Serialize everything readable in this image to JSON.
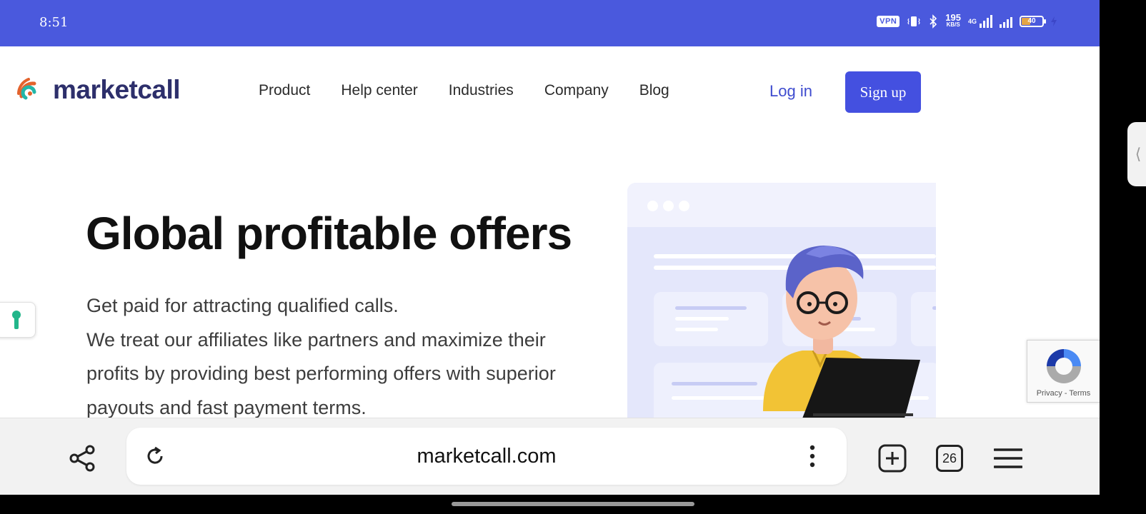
{
  "status_bar": {
    "time": "8:51",
    "vpn": "VPN",
    "speed_value": "195",
    "speed_unit": "KB/S",
    "network": "4G",
    "battery": "40",
    "bg_color": "#4a59dd"
  },
  "header": {
    "logo_text": "marketcall",
    "nav": [
      "Product",
      "Help center",
      "Industries",
      "Company",
      "Blog"
    ],
    "login_label": "Log in",
    "signup_label": "Sign up",
    "accent_color": "#4450e0"
  },
  "hero": {
    "title": "Global profitable offers",
    "line1": "Get paid for attracting qualified calls.",
    "line2": "We treat our affiliates like partners and maximize their profits by providing best performing offers with superior payouts and fast payment terms."
  },
  "recaptcha": {
    "privacy": "Privacy",
    "separator": "-",
    "terms": "Terms"
  },
  "browser": {
    "url": "marketcall.com",
    "tab_count": "26",
    "icons": [
      "share-icon",
      "reload-icon",
      "more-vertical-icon",
      "new-tab-icon",
      "tabs-icon",
      "menu-icon"
    ]
  }
}
